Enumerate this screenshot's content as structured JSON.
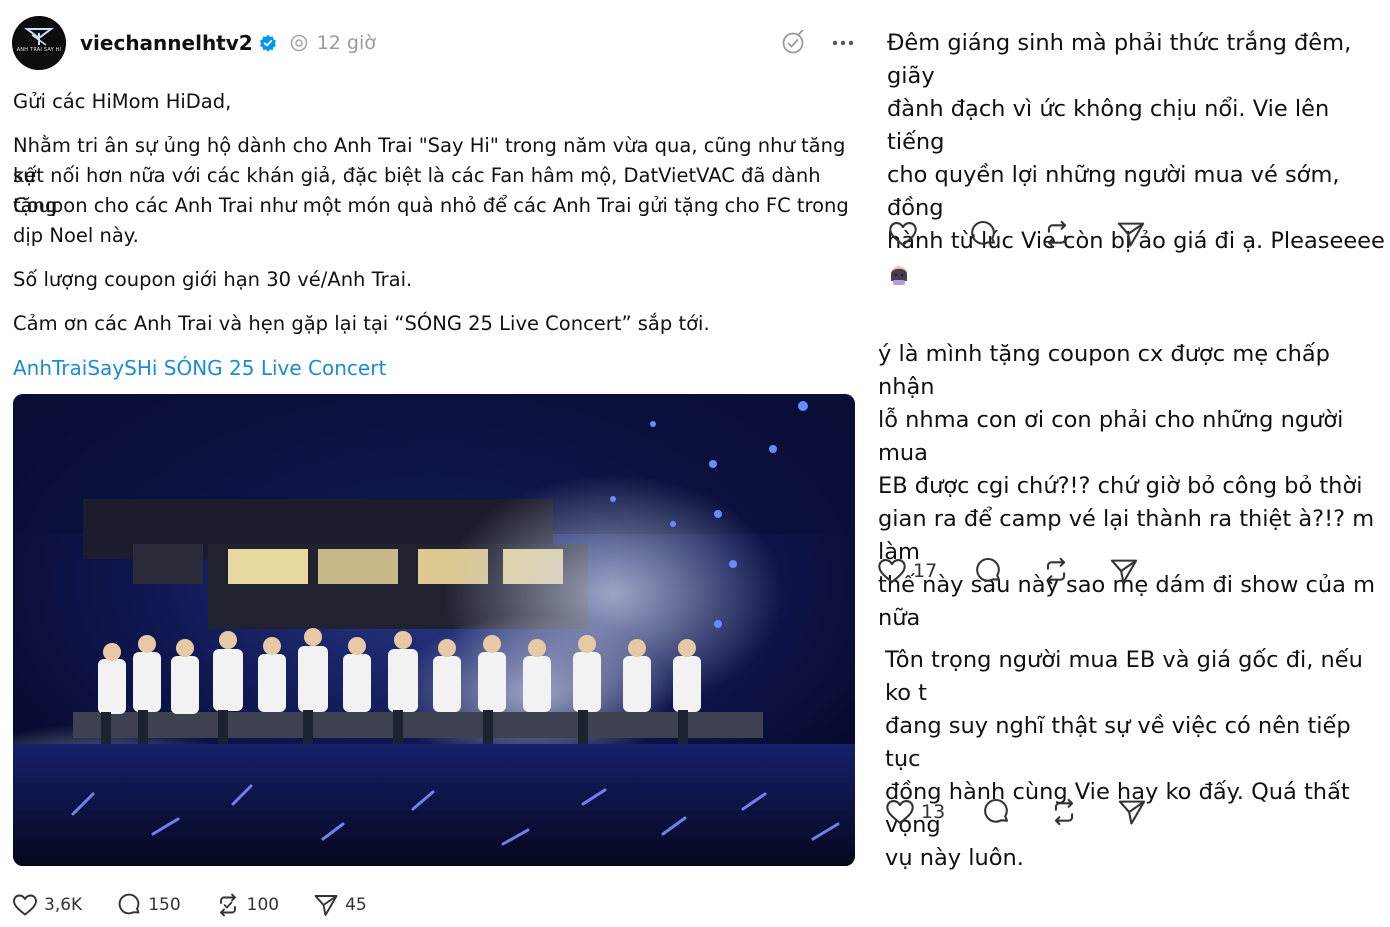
{
  "post": {
    "username": "viechannelhtv2",
    "time": "12 giờ",
    "avatar_logo_text": "ANH TRAI SAY HI",
    "paragraphs": [
      "Gửi các HiMom HiDad,",
      "Nhằm tri ân sự ủng hộ dành cho Anh Trai \"Say Hi\" trong năm vừa qua, cũng như tăng sự",
      "kết nối hơn nữa với các khán giả, đặc biệt là các Fan hâm mộ, DatVietVAC đã dành tặng",
      "Coupon cho các Anh Trai như một món quà nhỏ để các Anh Trai gửi tặng cho FC trong",
      "dịp Noel này.",
      "Số lượng coupon giới hạn 30 vé/Anh Trai.",
      "Cảm ơn các Anh Trai và hẹn gặp lại tại “SÓNG 25 Live Concert” sắp tới."
    ],
    "link_text": "AnhTraiSaySHi SÓNG 25 Live Concert",
    "likes": "3,6K",
    "comments": "150",
    "reposts": "100",
    "shares": "45"
  },
  "replies": [
    {
      "lines": [
        "Đêm giáng sinh mà phải thức trắng đêm, giãy",
        "đành đạch vì ức không chịu nổi. Vie lên tiếng",
        "cho quyền lợi những người mua vé sớm, đồng",
        "hành từ lúc Vie còn bị ảo giá đi ạ. Pleaseeee"
      ],
      "likes": ""
    },
    {
      "lines": [
        "ý là mình tặng coupon cx được mẹ chấp nhận",
        "lỗ nhma con ơi con phải cho những người mua",
        "EB được cgi chứ?!? chứ giờ bỏ công bỏ thời",
        "gian ra để camp vé lại thành ra thiệt à?!? m làm",
        "thế này sau này sao mẹ dám đi show của m",
        "nữa"
      ],
      "likes": "17"
    },
    {
      "lines": [
        "Tôn trọng người mua EB và giá gốc đi, nếu ko t",
        "đang suy nghĩ thật sự về việc có nên tiếp tục",
        "đồng hành cùng Vie hay ko đấy. Quá thất vọng",
        "vụ này luôn."
      ],
      "likes": "13"
    }
  ],
  "colors": {
    "link": "#1a8bd6",
    "verified": "#0095f6",
    "muted": "#9a9a9a"
  }
}
